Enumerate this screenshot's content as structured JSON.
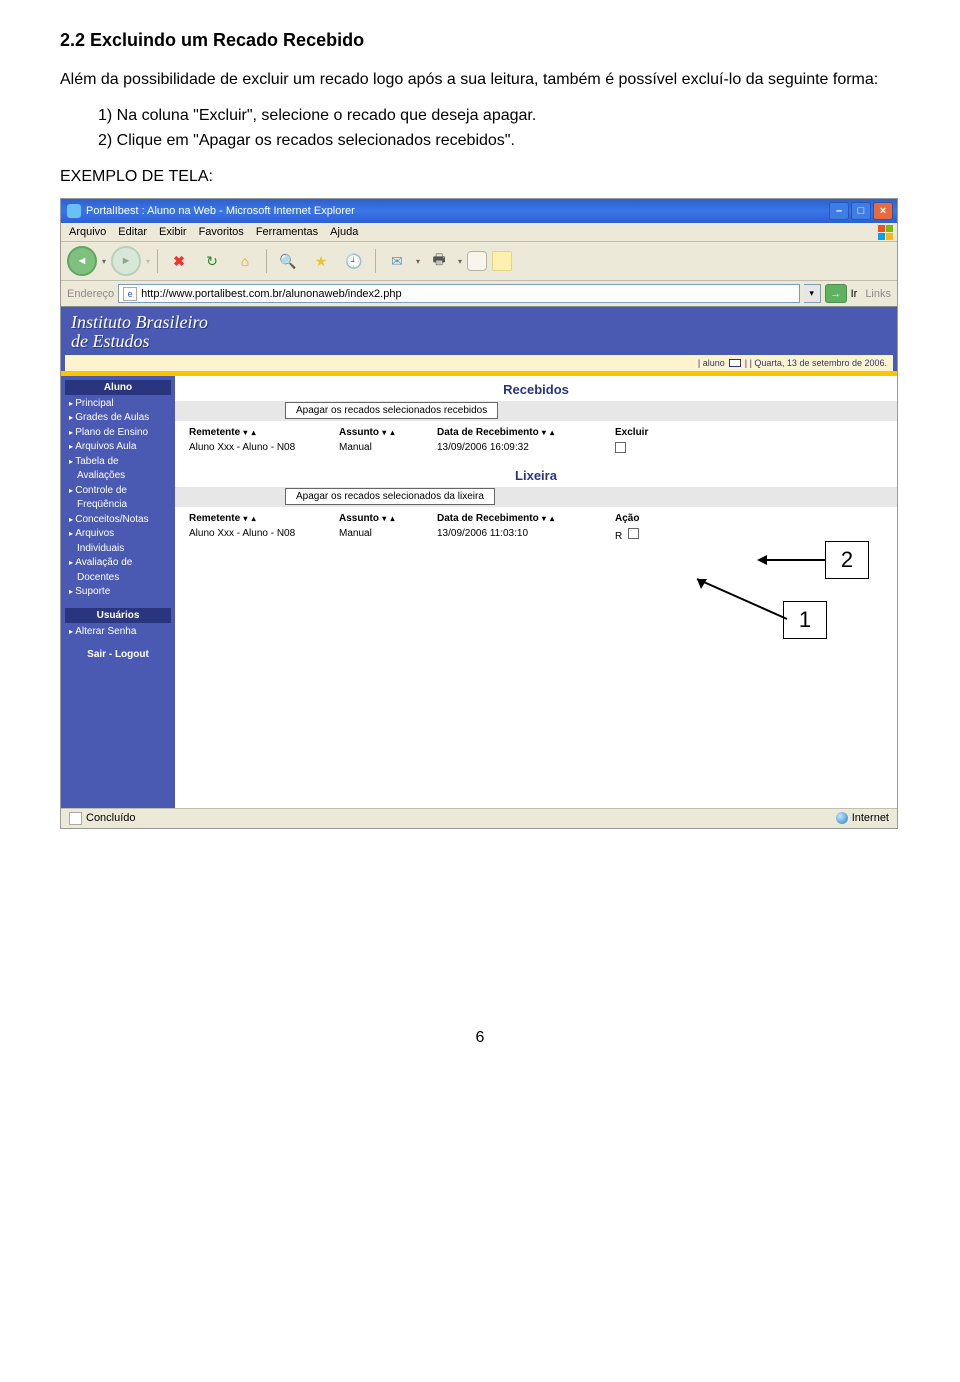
{
  "section": {
    "title": "2.2 Excluindo um Recado Recebido",
    "intro": "Além da possibilidade de excluir um recado logo após a sua leitura, também é possível excluí-lo da seguinte forma:",
    "steps": [
      "1) Na coluna \"Excluir\", selecione o recado que deseja apagar.",
      "2) Clique em \"Apagar os recados selecionados recebidos\"."
    ],
    "example_label_prefix": "E",
    "example_label_rest": "XEMPLO DE ",
    "example_label_t": "T",
    "example_label_ela": "ELA:"
  },
  "browser": {
    "title": "PortalIbest : Aluno na Web - Microsoft Internet Explorer",
    "menu": [
      "Arquivo",
      "Editar",
      "Exibir",
      "Favoritos",
      "Ferramentas",
      "Ajuda"
    ],
    "address_label": "Endereço",
    "url": "http://www.portalibest.com.br/alunonaweb/index2.php",
    "go_label": "Ir",
    "links_label": "Links",
    "status_left": "Concluído",
    "status_right": "Internet"
  },
  "app": {
    "logo_line1": "Instituto Brasileiro",
    "logo_line2": "de Estudos",
    "header_user": "| aluno",
    "header_date": "| | Quarta, 13 de setembro de 2006.",
    "sidebar": {
      "aluno_head": "Aluno",
      "aluno_items": [
        "Principal",
        "Grades de Aulas",
        "Plano de Ensino",
        "Arquivos Aula",
        "Tabela de",
        "Avaliações",
        "Controle de",
        "Freqüência",
        "Conceitos/Notas",
        "Arquivos",
        "Individuais",
        "Avaliação de",
        "Docentes",
        "Suporte"
      ],
      "usuarios_head": "Usuários",
      "usuarios_items": [
        "Alterar Senha"
      ],
      "logout": "Sair - Logout"
    },
    "recebidos": {
      "title": "Recebidos",
      "action": "Apagar os recados selecionados recebidos",
      "headers": {
        "remetente": "Remetente",
        "assunto": "Assunto",
        "data": "Data de Recebimento",
        "excluir": "Excluir"
      },
      "row": {
        "remetente": "Aluno Xxx - Aluno - N08",
        "assunto": "Manual",
        "data": "13/09/2006 16:09:32"
      }
    },
    "lixeira": {
      "title": "Lixeira",
      "action": "Apagar os recados selecionados da lixeira",
      "headers": {
        "remetente": "Remetente",
        "assunto": "Assunto",
        "data": "Data de Recebimento",
        "acao": "Ação"
      },
      "row": {
        "remetente": "Aluno Xxx - Aluno - N08",
        "assunto": "Manual",
        "data": "13/09/2006 11:03:10",
        "acao": "R"
      }
    }
  },
  "callouts": {
    "one": "1",
    "two": "2"
  },
  "page_number": "6"
}
